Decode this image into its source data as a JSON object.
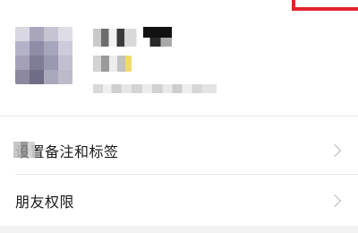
{
  "contact": {
    "name": "",
    "alias": "",
    "details": ""
  },
  "menu": {
    "items": [
      {
        "label": "设置备注和标签"
      },
      {
        "label": "朋友权限"
      }
    ]
  },
  "colors": {
    "highlight_frame": "#e0242e",
    "divider": "#e8e8e8",
    "chevron": "#b8b8b8"
  },
  "icons": {
    "row_chevron": "chevron-right-icon"
  }
}
